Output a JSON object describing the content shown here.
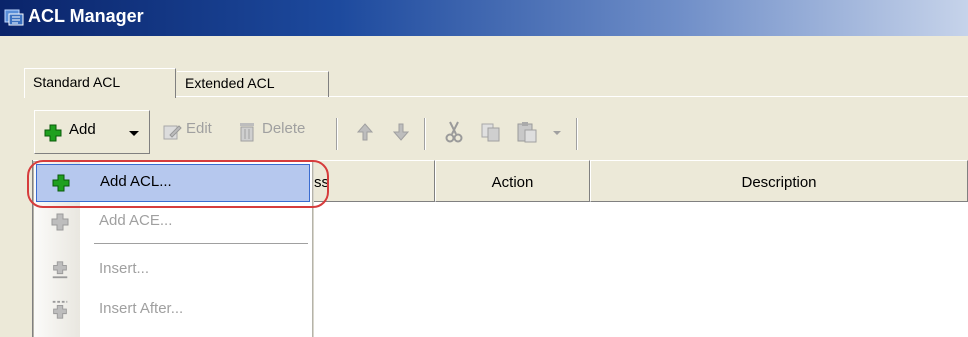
{
  "window": {
    "title": "ACL Manager"
  },
  "tabs": [
    {
      "label": "Standard ACL",
      "active": true
    },
    {
      "label": "Extended ACL",
      "active": false
    }
  ],
  "toolbar": {
    "add_label": "Add",
    "edit_label": "Edit",
    "delete_label": "Delete"
  },
  "table": {
    "columns": [
      "ss",
      "Action",
      "Description"
    ]
  },
  "add_menu": {
    "items": [
      {
        "label": "Add ACL...",
        "enabled": true,
        "highlighted": true,
        "icon": "plus-green-icon"
      },
      {
        "label": "Add ACE...",
        "enabled": false,
        "icon": "plus-gray-icon"
      },
      {
        "label": "Insert...",
        "enabled": false,
        "icon": "insert-icon"
      },
      {
        "label": "Insert After...",
        "enabled": false,
        "icon": "insert-after-icon"
      }
    ]
  },
  "colors": {
    "titlebar_start": "#0a246a",
    "highlight": "#b6c8ee",
    "highlight_border": "#3a6cd0",
    "callout": "#d63c3c",
    "add_green": "#1fa01f"
  }
}
